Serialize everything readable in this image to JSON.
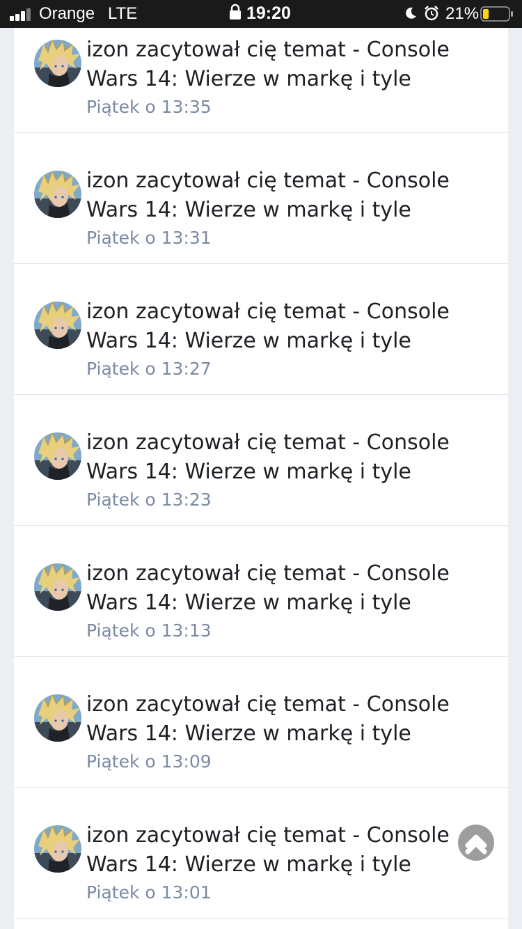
{
  "status_bar": {
    "carrier": "Orange",
    "network": "LTE",
    "time": "19:20",
    "battery_percent": "21%",
    "icons": [
      "signal-icon",
      "lock-icon",
      "moon-icon",
      "alarm-icon",
      "battery-icon"
    ]
  },
  "notifications": [
    {
      "title": "izon zacytował cię temat - Console Wars 14: Wierze w markę i tyle",
      "time": "Piątek o 13:35"
    },
    {
      "title": "izon zacytował cię temat - Console Wars 14: Wierze w markę i tyle",
      "time": "Piątek o 13:31"
    },
    {
      "title": "izon zacytował cię temat - Console Wars 14: Wierze w markę i tyle",
      "time": "Piątek o 13:27"
    },
    {
      "title": "izon zacytował cię temat - Console Wars 14: Wierze w markę i tyle",
      "time": "Piątek o 13:23"
    },
    {
      "title": "izon zacytował cię temat - Console Wars 14: Wierze w markę i tyle",
      "time": "Piątek o 13:13"
    },
    {
      "title": "izon zacytował cię temat - Console Wars 14: Wierze w markę i tyle",
      "time": "Piątek o 13:09"
    },
    {
      "title": "izon zacytował cię temat - Console Wars 14: Wierze w markę i tyle",
      "time": "Piątek o 13:01"
    }
  ],
  "scroll_top": {
    "icon": "chevron-up-icon"
  },
  "colors": {
    "status_bar_bg": "#1a1a1a",
    "page_bg": "#ebeef2",
    "title_text": "#1e1f24",
    "time_text": "#7b8aa3",
    "battery_fill": "#ffd60a"
  }
}
